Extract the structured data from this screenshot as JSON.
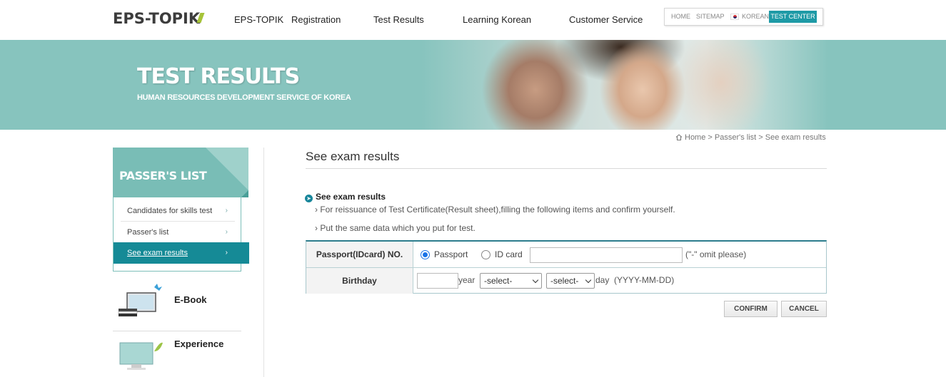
{
  "header": {
    "logo": "EPS-TOPIK",
    "nav": [
      "EPS-TOPIK",
      "Registration",
      "Test Results",
      "Learning Korean",
      "Customer Service"
    ],
    "util": {
      "home": "HOME",
      "sitemap": "SITEMAP",
      "korean": "KOREAN",
      "test_center": "TEST CENTER"
    }
  },
  "banner": {
    "title": "TEST RESULTS",
    "subtitle": "HUMAN RESOURCES DEVELOPMENT SERVICE OF KOREA"
  },
  "sidebar": {
    "heading": "PASSER'S LIST",
    "items": [
      {
        "label": "Candidates for skills test"
      },
      {
        "label": "Passer's list"
      },
      {
        "label": "See exam results"
      }
    ],
    "chevron": "›",
    "promos": [
      {
        "label": "E-Book"
      },
      {
        "label": "Experience"
      }
    ]
  },
  "breadcrumb": "Home > Passer's list > See exam results",
  "main": {
    "title": "See exam results",
    "section_heading": "See exam results",
    "notes": [
      "For reissuance of Test Certificate(Result sheet),filling the following items and confirm yourself.",
      "Put the same data which you put for test."
    ],
    "note_marker": "›"
  },
  "form": {
    "passport_label": "Passport(IDcard) NO.",
    "passport_option": "Passport",
    "idcard_option": "ID card",
    "id_value": "",
    "id_hint": "(\"-\" omit please)",
    "birthday_label": "Birthday",
    "year_value": "",
    "year_suffix": "year",
    "month_select": "-select-",
    "day_select": "-select-",
    "day_suffix": "day  (YYYY-MM-DD)"
  },
  "buttons": {
    "confirm": "CONFIRM",
    "cancel": "CANCEL"
  },
  "colors": {
    "banner": "#87c4be",
    "accent": "#158a96",
    "test_center": "#1e9aa6"
  }
}
